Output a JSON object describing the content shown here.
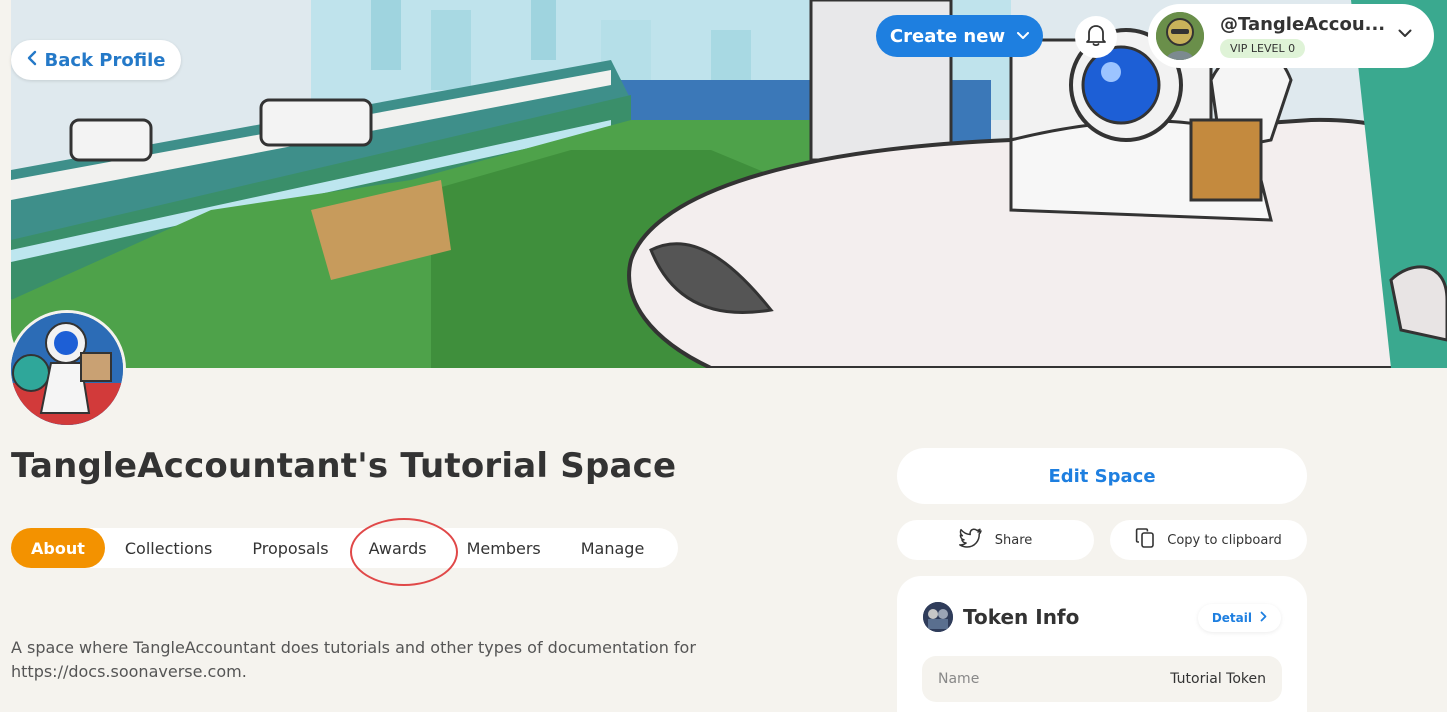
{
  "header": {
    "back_label": "Back Profile",
    "create_label": "Create new",
    "profile_name": "@TangleAccou...",
    "vip_label": "VIP LEVEL 0"
  },
  "space": {
    "title": "TangleAccountant's Tutorial Space",
    "description": "A space where TangleAccountant does tutorials and other types of documentation for https://docs.soonaverse.com."
  },
  "tabs": [
    {
      "label": "About",
      "active": true
    },
    {
      "label": "Collections",
      "active": false
    },
    {
      "label": "Proposals",
      "active": false
    },
    {
      "label": "Awards",
      "active": false
    },
    {
      "label": "Members",
      "active": false
    },
    {
      "label": "Manage",
      "active": false
    }
  ],
  "sidebar": {
    "edit_label": "Edit Space",
    "share_label": "Share",
    "copy_label": "Copy to clipboard",
    "token": {
      "title": "Token Info",
      "detail_label": "Detail",
      "rows": [
        {
          "key": "Name",
          "value": "Tutorial Token"
        }
      ]
    }
  },
  "colors": {
    "accent_blue": "#1e7fe0",
    "active_tab": "#f39200",
    "highlight_circle": "#e04848",
    "background": "#f5f3ee"
  }
}
